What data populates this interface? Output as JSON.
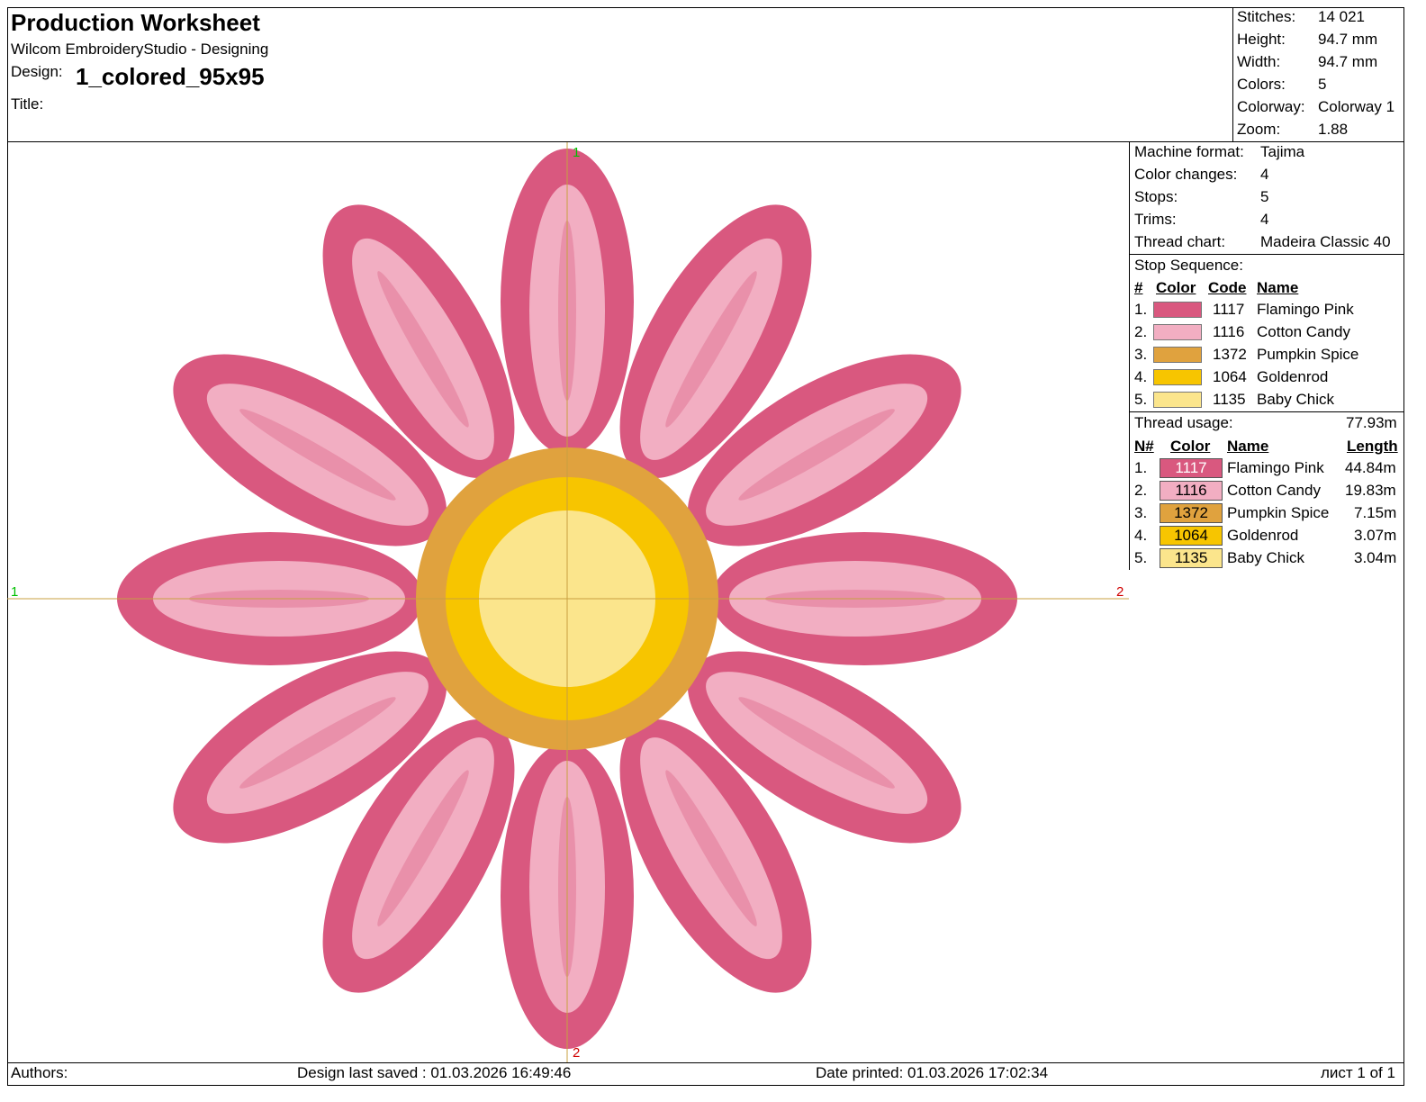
{
  "header": {
    "title": "Production Worksheet",
    "software": "Wilcom EmbroideryStudio - Designing",
    "design_label": "Design:",
    "design_name": "1_colored_95x95",
    "title_label": "Title:"
  },
  "summary": [
    {
      "label": "Stitches:",
      "value": "14 021"
    },
    {
      "label": "Height:",
      "value": "94.7 mm"
    },
    {
      "label": "Width:",
      "value": "94.7 mm"
    },
    {
      "label": "Colors:",
      "value": "5"
    },
    {
      "label": "Colorway:",
      "value": "Colorway 1"
    },
    {
      "label": "Zoom:",
      "value": "1.88"
    }
  ],
  "machine": [
    {
      "label": "Machine format:",
      "value": "Tajima"
    },
    {
      "label": "Color changes:",
      "value": "4"
    },
    {
      "label": "Stops:",
      "value": "5"
    },
    {
      "label": "Trims:",
      "value": "4"
    },
    {
      "label": "Thread chart:",
      "value": "Madeira Classic 40"
    }
  ],
  "stop_sequence": {
    "title": "Stop Sequence:",
    "headers": {
      "num": "#",
      "color": "Color",
      "code": "Code",
      "name": "Name"
    },
    "rows": [
      {
        "num": "1.",
        "code": "1117",
        "name": "Flamingo Pink",
        "color": "#d9587f"
      },
      {
        "num": "2.",
        "code": "1116",
        "name": "Cotton Candy",
        "color": "#f2aec2"
      },
      {
        "num": "3.",
        "code": "1372",
        "name": "Pumpkin Spice",
        "color": "#e0a23e"
      },
      {
        "num": "4.",
        "code": "1064",
        "name": "Goldenrod",
        "color": "#f7c500"
      },
      {
        "num": "5.",
        "code": "1135",
        "name": "Baby Chick",
        "color": "#fbe58c"
      }
    ]
  },
  "thread_usage": {
    "title": "Thread usage:",
    "total": "77.93m",
    "headers": {
      "num": "N#",
      "color": "Color",
      "name": "Name",
      "length": "Length"
    },
    "rows": [
      {
        "num": "1.",
        "code": "1117",
        "name": "Flamingo Pink",
        "length": "44.84m",
        "color": "#d9587f",
        "text_color": "#ffffff"
      },
      {
        "num": "2.",
        "code": "1116",
        "name": "Cotton Candy",
        "length": "19.83m",
        "color": "#f2aec2",
        "text_color": "#000000"
      },
      {
        "num": "3.",
        "code": "1372",
        "name": "Pumpkin Spice",
        "length": "7.15m",
        "color": "#e0a23e",
        "text_color": "#000000"
      },
      {
        "num": "4.",
        "code": "1064",
        "name": "Goldenrod",
        "length": "3.07m",
        "color": "#f7c500",
        "text_color": "#000000"
      },
      {
        "num": "5.",
        "code": "1135",
        "name": "Baby Chick",
        "length": "3.04m",
        "color": "#fbe58c",
        "text_color": "#000000"
      }
    ]
  },
  "markers": {
    "left": "1",
    "right": "2",
    "top": "1",
    "bottom": "2"
  },
  "footer": {
    "authors": "Authors:",
    "last_saved": "Design last saved : 01.03.2026 16:49:46",
    "printed": "Date printed: 01.03.2026 17:02:34",
    "page": "лист 1 of 1"
  },
  "colors": {
    "petal_outer": "#d9587f",
    "petal_inner": "#f2aec2",
    "center_outer": "#e0a23e",
    "center_mid": "#f7c500",
    "center_inner": "#fbe58c"
  }
}
